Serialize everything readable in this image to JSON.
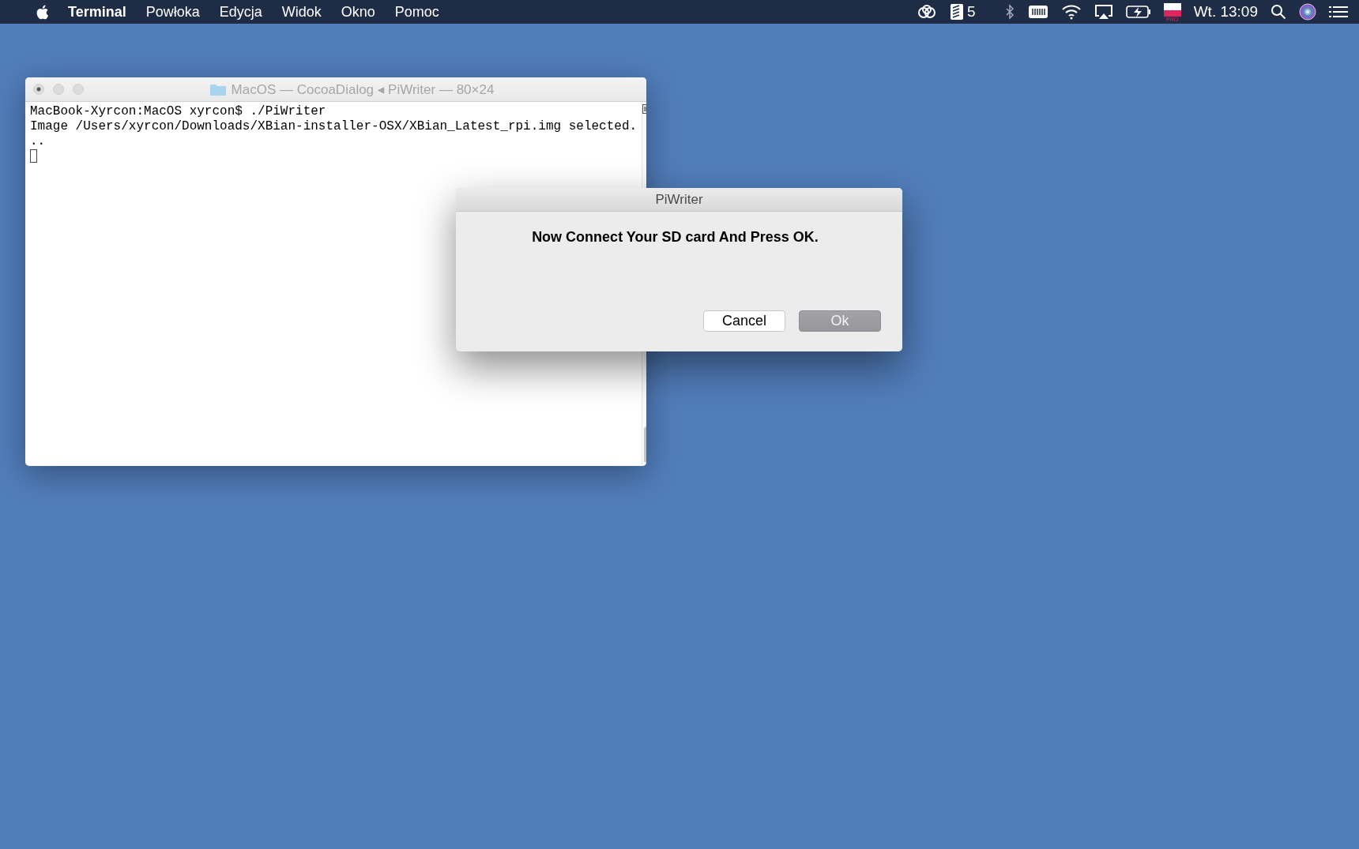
{
  "menu_bar": {
    "app_name": "Terminal",
    "menus": [
      "Powłoka",
      "Edycja",
      "Widok",
      "Okno",
      "Pomoc"
    ],
    "status": {
      "tasks_count": "5",
      "flag_label": "PRO",
      "clock": "Wt. 13:09"
    }
  },
  "terminal_window": {
    "title": "MacOS — CocoaDialog ◂ PiWriter — 80×24",
    "lines": [
      "MacBook-Xyrcon:MacOS xyrcon$ ./PiWriter",
      "Image /Users/xyrcon/Downloads/XBian-installer-OSX/XBian_Latest_rpi.img selected.",
      ".."
    ]
  },
  "dialog": {
    "title": "PiWriter",
    "message": "Now Connect Your SD card And Press OK.",
    "buttons": [
      {
        "label": "Cancel",
        "kind": "normal"
      },
      {
        "label": "Ok",
        "kind": "default"
      }
    ]
  }
}
